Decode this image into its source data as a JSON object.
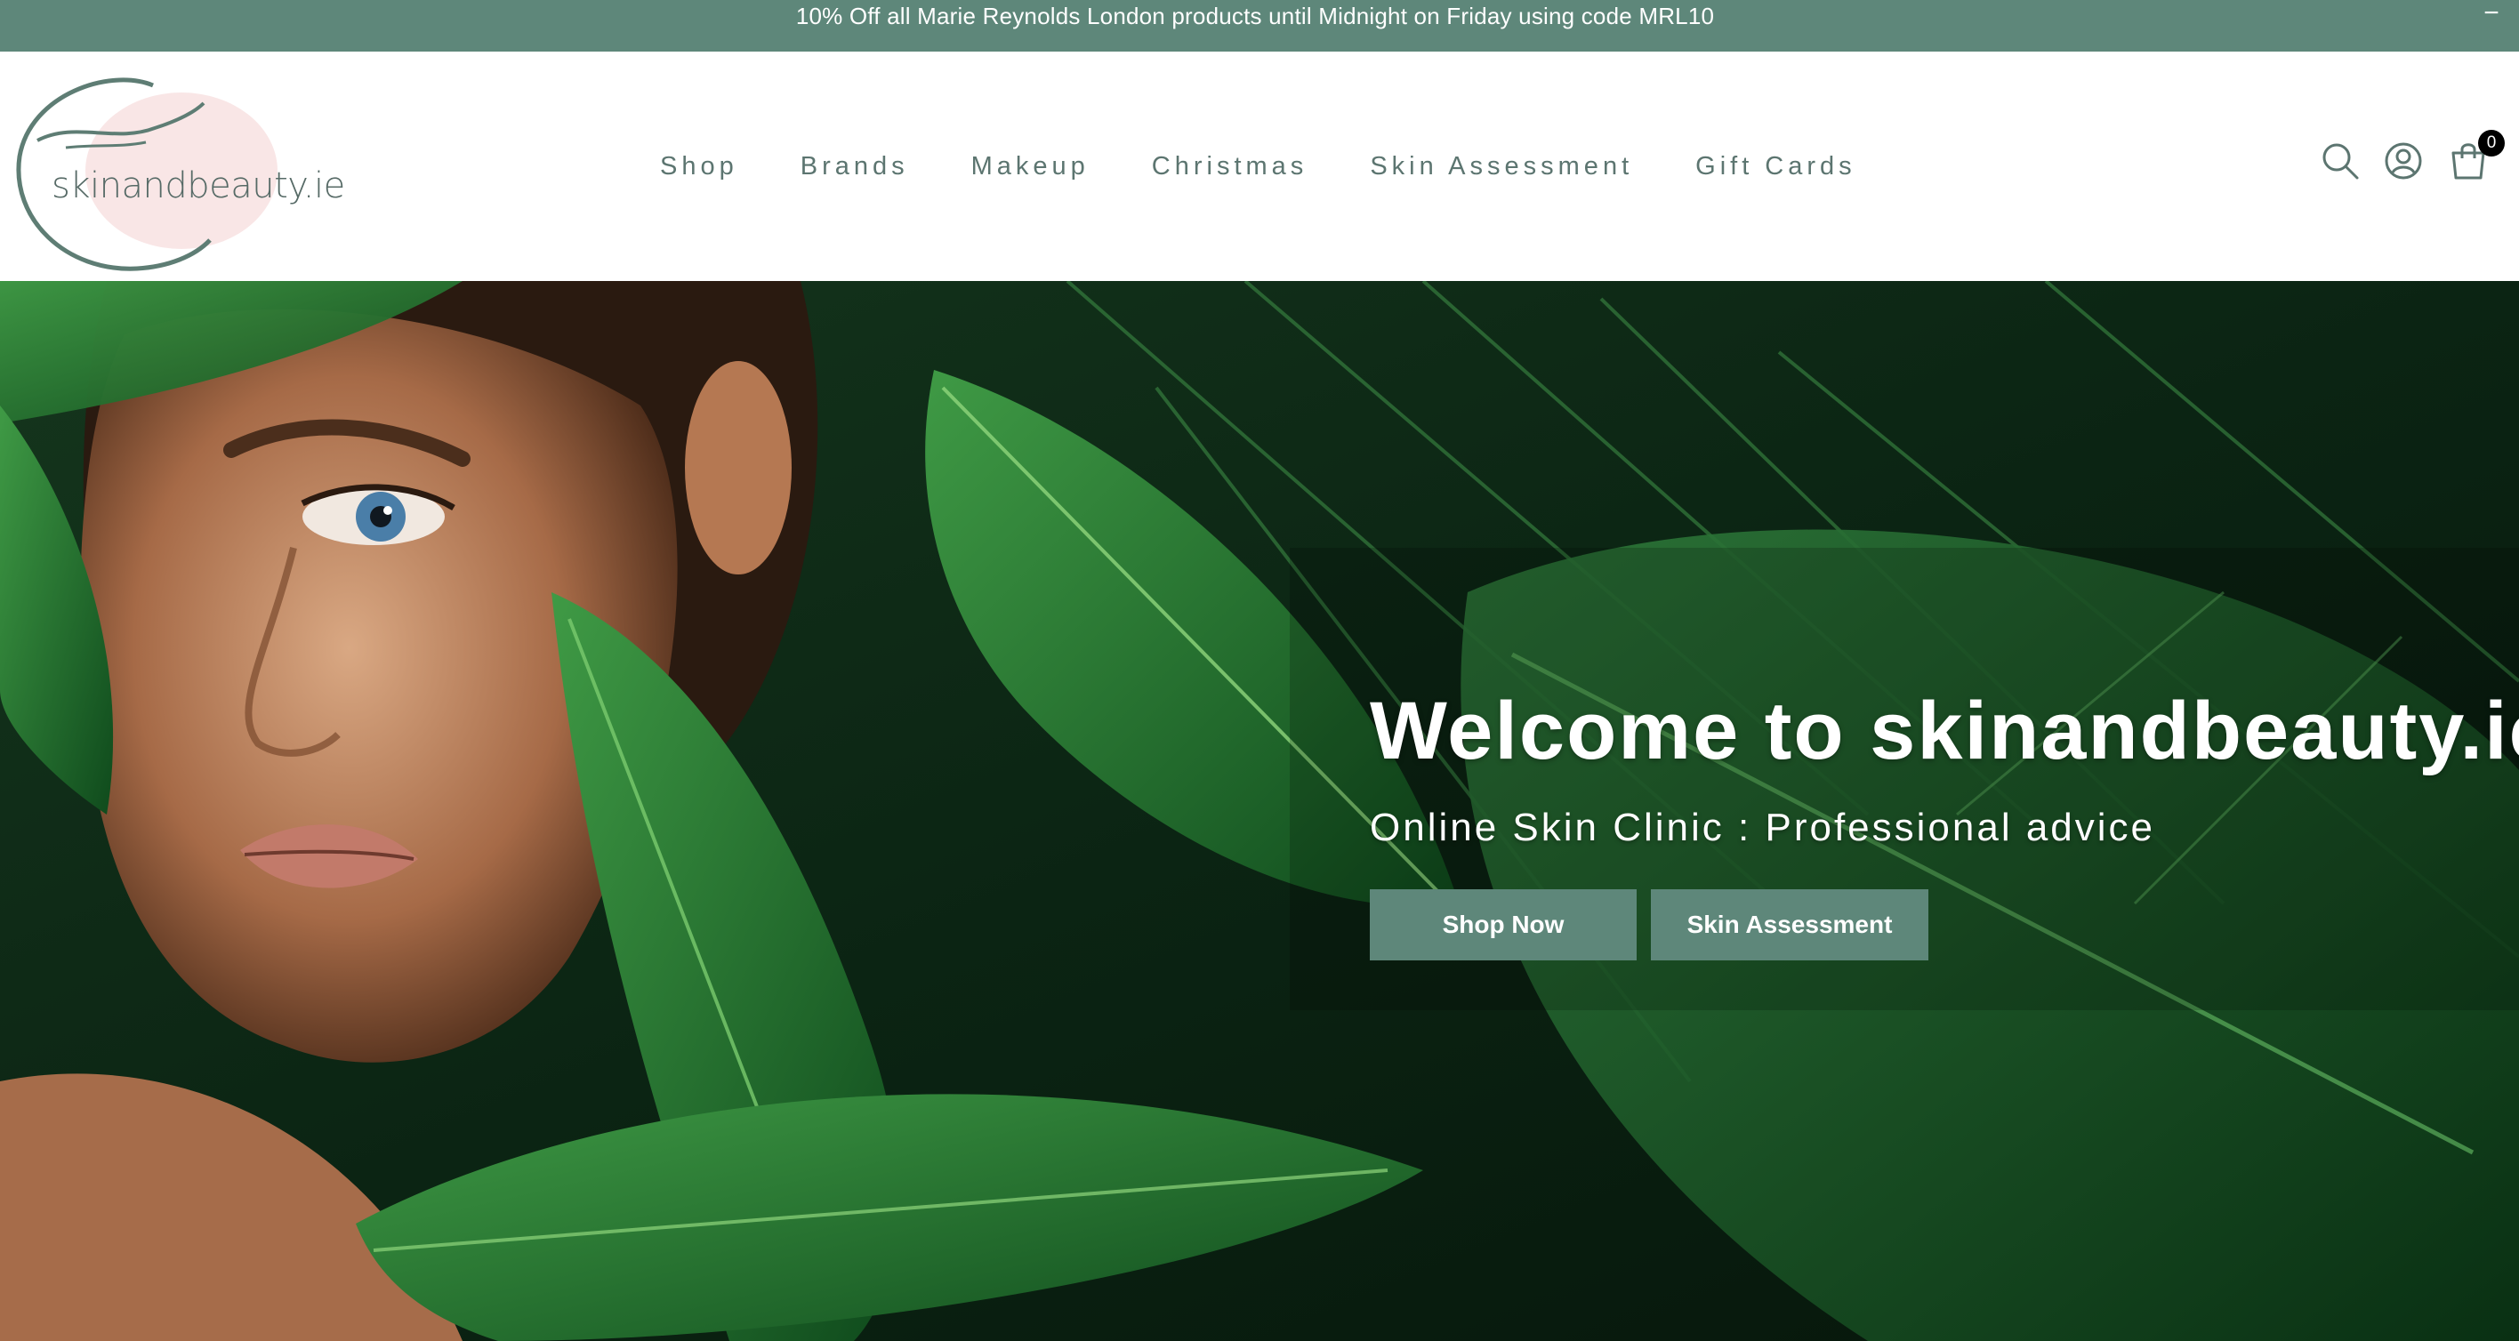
{
  "announcement": {
    "text": "10% Off all Marie Reynolds London products until Midnight on Friday using code MRL10",
    "close_symbol": "−"
  },
  "brand": {
    "logo_text": "skinandbeauty.ie",
    "color_primary": "#5e877a",
    "color_logo_blush": "#f6dada"
  },
  "nav": {
    "items": [
      {
        "label": "Shop"
      },
      {
        "label": "Brands"
      },
      {
        "label": "Makeup"
      },
      {
        "label": "Christmas"
      },
      {
        "label": "Skin Assessment"
      },
      {
        "label": "Gift Cards"
      }
    ]
  },
  "header_icons": {
    "search": "search-icon",
    "account": "account-icon",
    "cart": "cart-icon",
    "cart_count": "0"
  },
  "hero": {
    "title": "Welcome to skinandbeauty.ie",
    "subtitle": "Online Skin Clinic : Professional advice",
    "buttons": [
      {
        "label": "Shop Now"
      },
      {
        "label": "Skin Assessment"
      }
    ]
  }
}
